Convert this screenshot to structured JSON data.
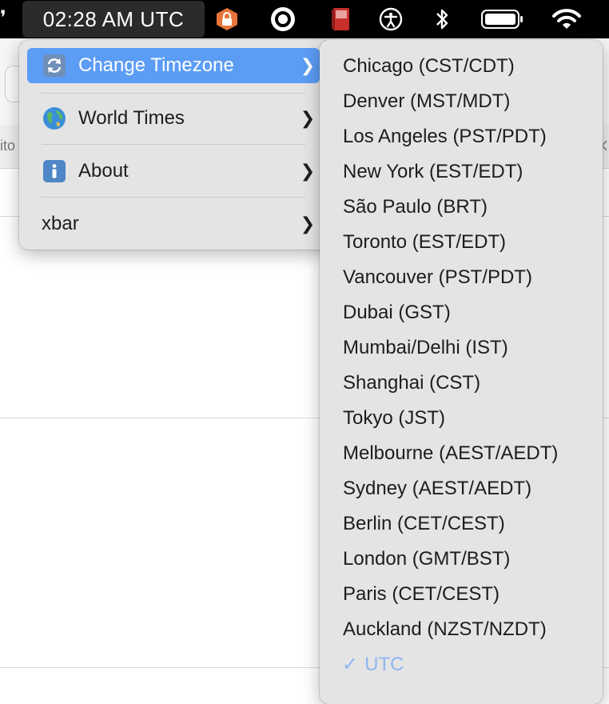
{
  "menubar": {
    "clock": "02:28 AM UTC",
    "icons": [
      "xbar-plugin-icon",
      "record-icon",
      "flashcard-app-icon",
      "accessibility-icon",
      "bluetooth-icon",
      "battery-icon",
      "wifi-icon"
    ]
  },
  "background": {
    "partial_text": "ito"
  },
  "menu": {
    "items": [
      {
        "label": "Change Timezone",
        "icon": "refresh-icon",
        "selected": true
      },
      {
        "label": "World Times",
        "icon": "globe-icon"
      },
      {
        "label": "About",
        "icon": "info-icon"
      },
      {
        "label": "xbar"
      }
    ]
  },
  "submenu": {
    "items": [
      "Chicago (CST/CDT)",
      "Denver (MST/MDT)",
      "Los Angeles (PST/PDT)",
      "New York (EST/EDT)",
      "São Paulo (BRT)",
      "Toronto (EST/EDT)",
      "Vancouver (PST/PDT)",
      "Dubai (GST)",
      "Mumbai/Delhi (IST)",
      "Shanghai (CST)",
      "Tokyo (JST)",
      "Melbourne (AEST/AEDT)",
      "Sydney (AEST/AEDT)",
      "Berlin (CET/CEST)",
      "London (GMT/BST)",
      "Paris (CET/CEST)",
      "Auckland (NZST/NZDT)"
    ],
    "checked_item": "UTC",
    "check_mark": "✓"
  },
  "colors": {
    "selection": "#5b9cf5",
    "checked_text": "#8fb6ef",
    "menu_bg": "#e4e4e4"
  }
}
